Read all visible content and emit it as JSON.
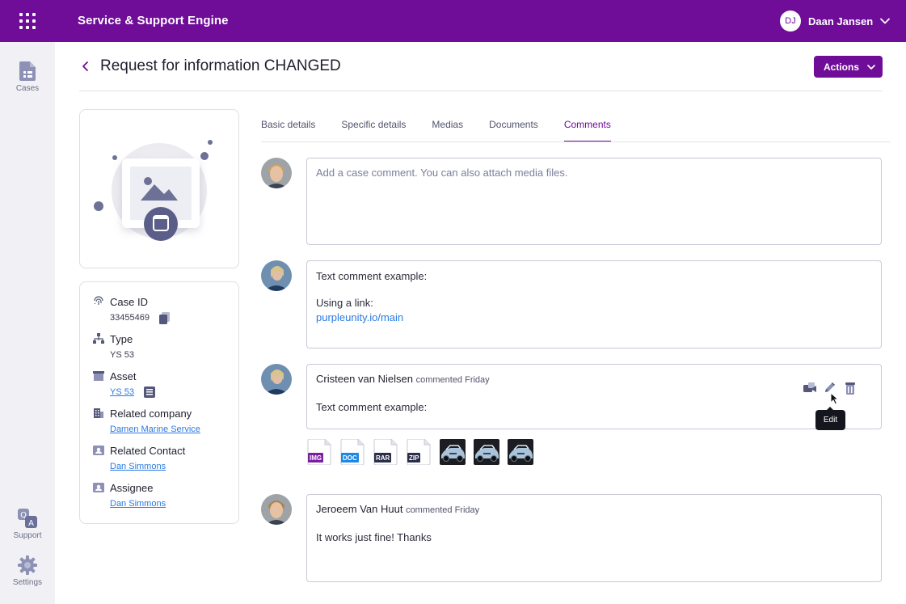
{
  "app": {
    "title": "Service & Support Engine"
  },
  "user": {
    "initials": "DJ",
    "name": "Daan Jansen"
  },
  "sidebar": {
    "items": [
      {
        "label": "Cases"
      },
      {
        "label": "Support"
      },
      {
        "label": "Settings"
      }
    ]
  },
  "page": {
    "title": "Request for information CHANGED",
    "actions_label": "Actions"
  },
  "case": {
    "fields": [
      {
        "label": "Case ID",
        "value": "33455469"
      },
      {
        "label": "Type",
        "value": "YS 53"
      },
      {
        "label": "Asset",
        "value": "YS 53"
      },
      {
        "label": "Related company",
        "value": "Damen Marine Service"
      },
      {
        "label": "Related Contact",
        "value": "Dan Simmons"
      },
      {
        "label": "Assignee",
        "value": "Dan Simmons"
      }
    ]
  },
  "tabs": [
    {
      "label": "Basic details"
    },
    {
      "label": "Specific details"
    },
    {
      "label": "Medias"
    },
    {
      "label": "Documents"
    },
    {
      "label": "Comments",
      "active": true
    }
  ],
  "comment_input": {
    "placeholder": "Add a case comment. You can also attach media files."
  },
  "comments": [
    {
      "line1": "Text comment example:",
      "line2": "Using a link:",
      "link": "purpleunity.io/main"
    },
    {
      "author": "Cristeen van Nielsen",
      "meta": "commented Friday",
      "text": "Text comment example:"
    },
    {
      "author": "Jeroeem Van Huut",
      "meta": "commented Friday",
      "text": "It works just fine! Thanks"
    }
  ],
  "tooltip": {
    "edit": "Edit"
  },
  "attachments": [
    {
      "badge": "IMG",
      "color": "#7b1fa2"
    },
    {
      "badge": "DOC",
      "color": "#1e88e5"
    },
    {
      "badge": "RAR",
      "color": "#2c2f4a"
    },
    {
      "badge": "ZIP",
      "color": "#2c2f4a"
    }
  ],
  "colors": {
    "brand": "#6f0c98",
    "link": "#2a7ae2",
    "sidebar_bg": "#f1f1f5"
  }
}
